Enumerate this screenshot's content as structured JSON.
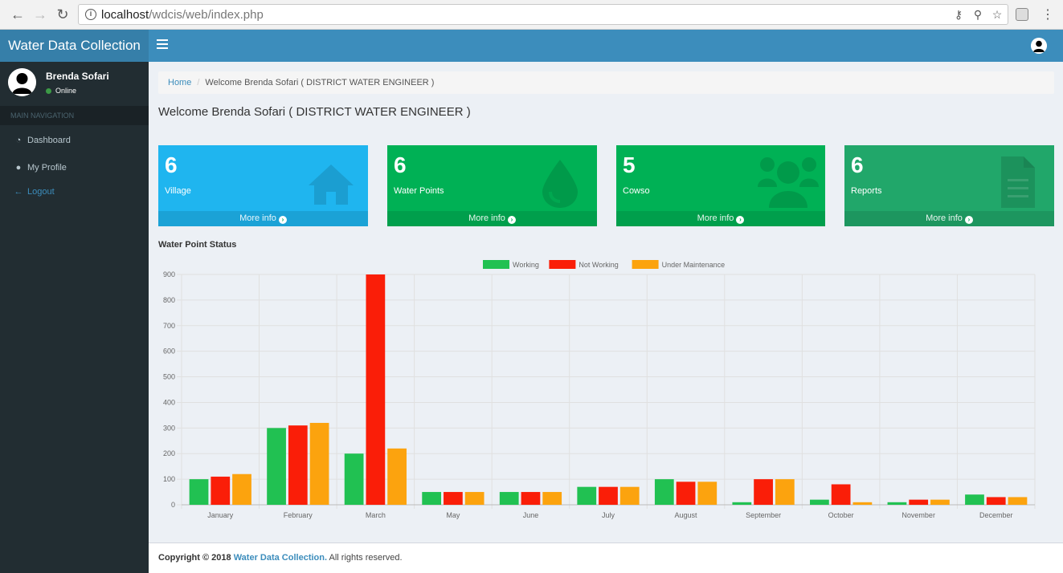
{
  "browser": {
    "url_host": "localhost",
    "url_path": "/wdcis/web/index.php"
  },
  "header": {
    "logo": "Water Data Collection"
  },
  "sidebar": {
    "user_name": "Brenda Sofari",
    "user_status": "Online",
    "nav_header": "MAIN NAVIGATION",
    "items": [
      {
        "label": "Dashboard",
        "icon": "dashboard-icon"
      },
      {
        "label": "My Profile",
        "icon": "user-icon"
      },
      {
        "label": "Logout",
        "icon": "arrow-left-icon"
      }
    ]
  },
  "breadcrumb": {
    "home": "Home",
    "current": "Welcome Brenda Sofari ( DISTRICT WATER ENGINEER )"
  },
  "page_title": "Welcome Brenda Sofari ( DISTRICT WATER ENGINEER )",
  "boxes": [
    {
      "value": "6",
      "label": "Village",
      "more": "More info",
      "color": "#1fb5ef",
      "icon": "home-icon"
    },
    {
      "value": "6",
      "label": "Water Points",
      "more": "More info",
      "color": "#00b155",
      "icon": "water-drop-icon"
    },
    {
      "value": "5",
      "label": "Cowso",
      "more": "More info",
      "color": "#00b155",
      "icon": "users-icon"
    },
    {
      "value": "6",
      "label": "Reports",
      "more": "More info",
      "color": "#21a76a",
      "icon": "file-icon"
    }
  ],
  "chart_title": "Water Point Status",
  "chart_data": {
    "type": "bar",
    "title": "Water Point Status",
    "categories": [
      "January",
      "February",
      "March",
      "May",
      "June",
      "July",
      "August",
      "September",
      "October",
      "November",
      "December"
    ],
    "series": [
      {
        "name": "Working",
        "color": "#21c152",
        "values": [
          100,
          300,
          200,
          50,
          50,
          70,
          100,
          10,
          20,
          10,
          40
        ]
      },
      {
        "name": "Not Working",
        "color": "#fa1e08",
        "values": [
          110,
          310,
          900,
          50,
          50,
          70,
          90,
          100,
          80,
          20,
          30
        ]
      },
      {
        "name": "Under Maintenance",
        "color": "#fca30e",
        "values": [
          120,
          320,
          220,
          50,
          50,
          70,
          90,
          100,
          10,
          20,
          30
        ]
      }
    ],
    "ylim": [
      0,
      900
    ],
    "yticks": [
      0,
      100,
      200,
      300,
      400,
      500,
      600,
      700,
      800,
      900
    ],
    "legend": "top-center",
    "grid": true
  },
  "footer": {
    "copyright": "Copyright © 2018",
    "brand": "Water Data Collection.",
    "rights": "All rights reserved."
  }
}
